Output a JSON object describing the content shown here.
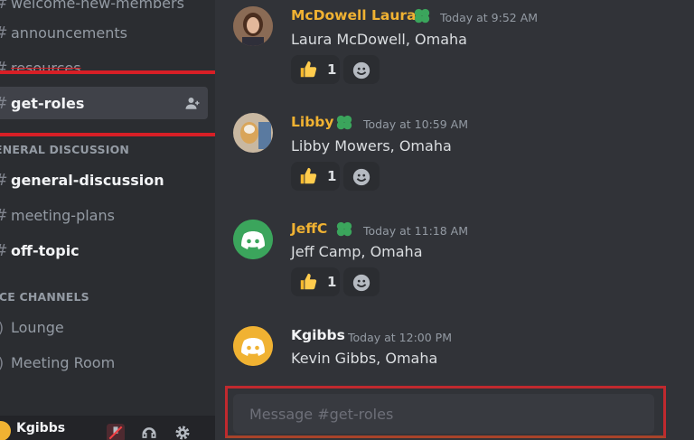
{
  "sidebar": {
    "channels_top": [
      {
        "label": "welcome-new-members"
      },
      {
        "label": "announcements"
      },
      {
        "label": "resources"
      },
      {
        "label": "get-roles"
      }
    ],
    "categories": {
      "general": "ENERAL DISCUSSION",
      "voice": "ICE CHANNELS"
    },
    "channels_general": [
      {
        "label": "general-discussion"
      },
      {
        "label": "meeting-plans"
      },
      {
        "label": "off-topic"
      }
    ],
    "channels_voice": [
      {
        "label": "Lounge"
      },
      {
        "label": "Meeting Room"
      }
    ]
  },
  "user_panel": {
    "username": "Kgibbs"
  },
  "messages": [
    {
      "author": "McDowell Laura",
      "timestamp": "Today at 9:52 AM",
      "content": "Laura McDowell, Omaha",
      "reaction_count": "1",
      "author_color": "#f0b232"
    },
    {
      "author": "Libby",
      "timestamp": "Today at 10:59 AM",
      "content": "Libby Mowers, Omaha",
      "reaction_count": "1",
      "author_color": "#f0b232"
    },
    {
      "author": "JeffC",
      "timestamp": "Today at 11:18 AM",
      "content": "Jeff Camp, Omaha",
      "reaction_count": "1",
      "author_color": "#f0b232"
    },
    {
      "author": "Kgibbs",
      "timestamp": "Today at 12:00 PM",
      "content": "Kevin Gibbs, Omaha",
      "author_color": "#f2f3f5"
    }
  ],
  "composer": {
    "placeholder": "Message #get-roles"
  },
  "colors": {
    "highlight_red": "#d81f26",
    "badge_green": "#3ba55c",
    "discord_green": "#3ba55c",
    "discord_yellow": "#f0b232"
  }
}
